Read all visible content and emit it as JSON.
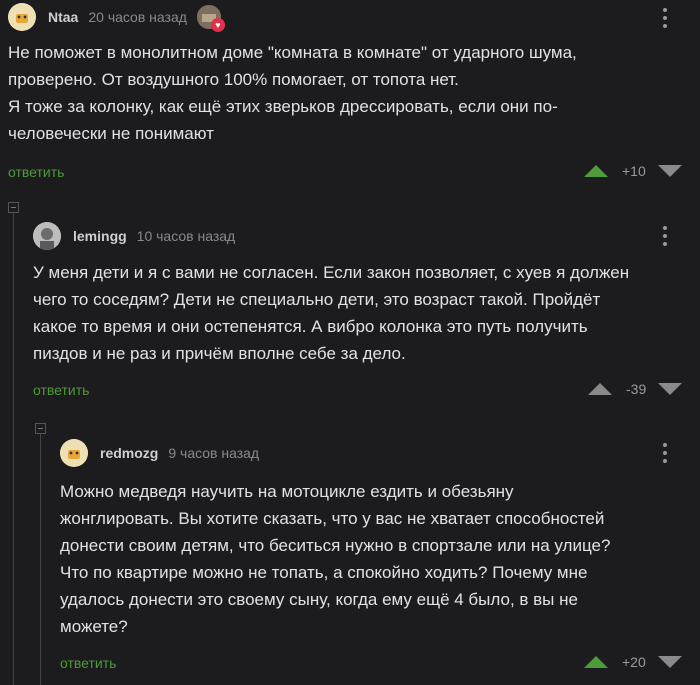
{
  "comments": [
    {
      "author": "Ntaa",
      "time": "20 часов назад",
      "text": "Не поможет в монолитном доме \"комната в комнате\" от ударного шума,\nпроверено. От воздушного 100% помогает, от топота нет.\nЯ тоже за колонку, как ещё этих зверьков дрессировать, если они по-\nчеловечески не понимают",
      "reply_label": "ответить",
      "score": "+10",
      "vote_state": "up"
    },
    {
      "author": "lemingg",
      "time": "10 часов назад",
      "text": "У меня дети и я с вами не согласен. Если закон позволяет, с хуев я должен\nчего то соседям? Дети не специально дети, это возраст такой. Пройдёт\nкакое то время и они остепенятся. А вибро колонка это путь получить\nпиздов и не раз и причём вполне себе за дело.",
      "reply_label": "ответить",
      "score": "-39",
      "vote_state": "none"
    },
    {
      "author": "redmozg",
      "time": "9 часов назад",
      "text": "Можно медведя научить на мотоцикле ездить и обезьяну\nжонглировать. Вы хотите сказать, что у вас не хватает способностей\nдонести своим детям, что беситься нужно в спортзале или на улице?\nЧто по квартире можно не топать, а спокойно ходить? Почему мне\nудалось донести это своему сыну, когда ему ещё 4 было, в вы не\nможете?",
      "reply_label": "ответить",
      "score": "+20",
      "vote_state": "up"
    }
  ],
  "colors": {
    "background": "#1c1c1e",
    "accent_green": "#4e9a3a",
    "muted": "#8a8a8a"
  }
}
